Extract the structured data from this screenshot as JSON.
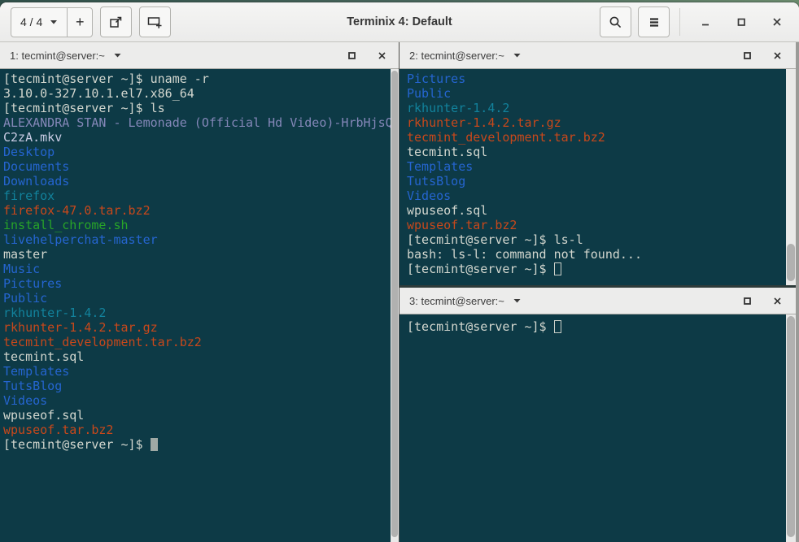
{
  "window": {
    "title": "Terminix 4: Default",
    "session_indicator": "4 / 4",
    "add_label": "+"
  },
  "palette": {
    "bg": "#0d3a46",
    "fg": "#d3d7cf",
    "dir": "#2565d0",
    "sym": "#12829c",
    "arc": "#c8481b",
    "scr": "#28a428",
    "med": "#8487b8",
    "medw": "#c9cce4"
  },
  "icons": {
    "session_caret": "caret-down-icon",
    "split_right": "split-terminal-right-icon",
    "split_down": "split-terminal-down-icon",
    "search": "search-icon",
    "menu": "hamburger-menu-icon",
    "minimize": "minimize-icon",
    "maximize": "maximize-icon",
    "close": "close-icon"
  },
  "panes": [
    {
      "title": "1: tecmint@server:~",
      "lines": [
        {
          "t": "[tecmint@server ~]$ uname -r",
          "c": "fg"
        },
        {
          "t": "3.10.0-327.10.1.el7.x86_64",
          "c": "fg"
        },
        {
          "t": "[tecmint@server ~]$ ls",
          "c": "fg"
        },
        {
          "t": "ALEXANDRA STAN - Lemonade (Official Hd Video)-HrbHjsQ",
          "c": "med"
        },
        {
          "t": "C2zA.mkv",
          "c": "medw"
        },
        {
          "t": "Desktop",
          "c": "dir"
        },
        {
          "t": "Documents",
          "c": "dir"
        },
        {
          "t": "Downloads",
          "c": "dir"
        },
        {
          "t": "firefox",
          "c": "sym"
        },
        {
          "t": "firefox-47.0.tar.bz2",
          "c": "arc"
        },
        {
          "t": "install_chrome.sh",
          "c": "scr"
        },
        {
          "t": "livehelperchat-master",
          "c": "dir"
        },
        {
          "t": "master",
          "c": "fg"
        },
        {
          "t": "Music",
          "c": "dir"
        },
        {
          "t": "Pictures",
          "c": "dir"
        },
        {
          "t": "Public",
          "c": "dir"
        },
        {
          "t": "rkhunter-1.4.2",
          "c": "sym"
        },
        {
          "t": "rkhunter-1.4.2.tar.gz",
          "c": "arc"
        },
        {
          "t": "tecmint_development.tar.bz2",
          "c": "arc"
        },
        {
          "t": "tecmint.sql",
          "c": "fg"
        },
        {
          "t": "Templates",
          "c": "dir"
        },
        {
          "t": "TutsBlog",
          "c": "dir"
        },
        {
          "t": "Videos",
          "c": "dir"
        },
        {
          "t": "wpuseof.sql",
          "c": "fg"
        },
        {
          "t": "wpuseof.tar.bz2",
          "c": "arc"
        },
        {
          "t": "[tecmint@server ~]$ ",
          "c": "fg",
          "cursor": "block"
        }
      ]
    },
    {
      "title": "2: tecmint@server:~",
      "lines": [
        {
          "t": "Pictures",
          "c": "dir"
        },
        {
          "t": "Public",
          "c": "dir"
        },
        {
          "t": "rkhunter-1.4.2",
          "c": "sym"
        },
        {
          "t": "rkhunter-1.4.2.tar.gz",
          "c": "arc"
        },
        {
          "t": "tecmint_development.tar.bz2",
          "c": "arc"
        },
        {
          "t": "tecmint.sql",
          "c": "fg"
        },
        {
          "t": "Templates",
          "c": "dir"
        },
        {
          "t": "TutsBlog",
          "c": "dir"
        },
        {
          "t": "Videos",
          "c": "dir"
        },
        {
          "t": "wpuseof.sql",
          "c": "fg"
        },
        {
          "t": "wpuseof.tar.bz2",
          "c": "arc"
        },
        {
          "t": "[tecmint@server ~]$ ls-l",
          "c": "fg"
        },
        {
          "t": "bash: ls-l: command not found...",
          "c": "fg"
        },
        {
          "t": "[tecmint@server ~]$ ",
          "c": "fg",
          "cursor": "outline"
        }
      ]
    },
    {
      "title": "3: tecmint@server:~",
      "lines": [
        {
          "t": "[tecmint@server ~]$ ",
          "c": "fg",
          "cursor": "outline"
        }
      ]
    }
  ]
}
